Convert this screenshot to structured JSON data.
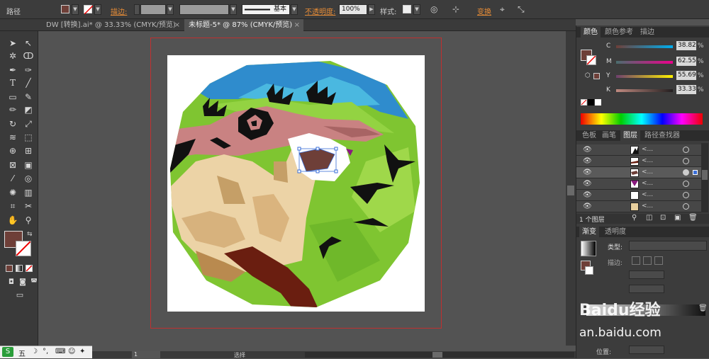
{
  "control_bar": {
    "selection_label": "路径",
    "stroke_label": "描边:",
    "stroke_profile": "基本",
    "opacity_label": "不透明度:",
    "opacity_value": "100%",
    "style_label": "样式:",
    "transform_label": "变换",
    "colors": {
      "fill": "#6e3f38",
      "accent": "#e78c36"
    }
  },
  "doc_tabs": [
    {
      "label": "DW [转换].ai* @ 33.33% (CMYK/预览)",
      "close": "×"
    },
    {
      "label": "未标题-5* @ 87% (CMYK/预览)",
      "close": "×"
    }
  ],
  "tools_panel": {
    "fill_color": "#6e3f38",
    "tools": [
      "selection-icon",
      "direct-selection-icon",
      "magic-wand-icon",
      "lasso-icon",
      "pen-icon",
      "curvature-icon",
      "type-icon",
      "line-icon",
      "rectangle-icon",
      "paintbrush-icon",
      "pencil-icon",
      "eraser-icon",
      "rotate-icon",
      "scale-icon",
      "width-icon",
      "free-transform-icon",
      "shape-builder-icon",
      "perspective-icon",
      "mesh-icon",
      "gradient-icon",
      "eyedropper-icon",
      "blend-icon",
      "symbol-sprayer-icon",
      "column-graph-icon",
      "artboard-icon",
      "slice-icon",
      "hand-icon",
      "zoom-icon"
    ]
  },
  "color_panel": {
    "tabs": [
      "颜色",
      "颜色参考",
      "描边"
    ],
    "channels": [
      {
        "label": "C",
        "value": "38.82",
        "unit": "%",
        "color": "#00aeef"
      },
      {
        "label": "M",
        "value": "62.55",
        "unit": "%",
        "color": "#ec008c"
      },
      {
        "label": "Y",
        "value": "55.69",
        "unit": "%",
        "color": "#fff200"
      },
      {
        "label": "K",
        "value": "33.33",
        "unit": "%",
        "color": "#231f20"
      }
    ]
  },
  "layers_panel": {
    "tabs": [
      "色板",
      "画笔",
      "图层",
      "路径查找器"
    ],
    "rows": [
      "<...",
      "<...",
      "<...",
      "<...",
      "<...",
      "<..."
    ],
    "footer": "1 个图层"
  },
  "gradient_panel": {
    "tabs": [
      "渐变",
      "透明度"
    ],
    "type_label": "类型:",
    "stroke_label": "描边:",
    "position_label": "位置:"
  },
  "watermark": {
    "site": "an.baidu.com",
    "brand": "Baidu经验"
  },
  "status_bar": {
    "zoom": "1",
    "mode": "选择"
  },
  "taskbar": {
    "ime": "五"
  }
}
